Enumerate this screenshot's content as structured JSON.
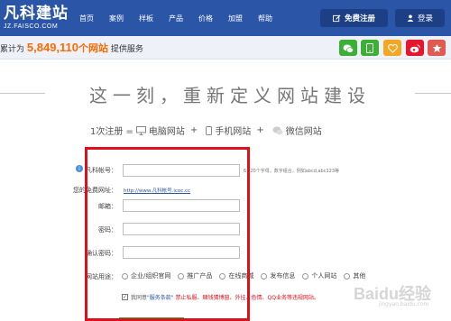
{
  "header": {
    "logo_main": "凡科建站",
    "logo_sub": "JZ.FAISCO.COM",
    "nav": [
      "首页",
      "案例",
      "样板",
      "产品",
      "价格",
      "加盟",
      "帮助"
    ],
    "register_label": "免费注册",
    "login_label": "登录"
  },
  "stats": {
    "prefix": "累计为",
    "count": "5,849,110",
    "unit": "个网站",
    "suffix": "提供服务"
  },
  "social": [
    {
      "icon": "wechat-icon",
      "color": "#3cb034"
    },
    {
      "icon": "mobile-icon",
      "color": "#3cb034"
    },
    {
      "icon": "heart-icon",
      "color": "#f5a623"
    },
    {
      "icon": "weibo-icon",
      "color": "#e6162d"
    },
    {
      "icon": "qzone-icon",
      "color": "#e05a52"
    }
  ],
  "slogan": "这一刻，重新定义网站建设",
  "subline": {
    "prefix": "1次注册 =",
    "pc": "电脑网站",
    "plus": "+",
    "mobile": "手机网站",
    "plus2": "+",
    "wechat": "微信网站"
  },
  "form": {
    "account_label": "凡科帐号：",
    "account_hint": "6~20个字母，数字组合，例如abcd,abc123等",
    "free_site_label": "您的免费网址：",
    "free_site_url": "http://www.凡科帐号.icoc.cc",
    "email_label": "邮箱：",
    "password_label": "密码：",
    "confirm_label": "确认密码：",
    "purpose_label": "网站用途：",
    "purpose_options": [
      "企业/组织官网",
      "推广产品",
      "在线商城",
      "发布信息",
      "个人网站",
      "其他"
    ],
    "agree_prefix": "我同意",
    "agree_terms": "\"服务条款\"",
    "agree_rest": "禁止私服、赌钱猜博窗、外挂、色情、QQ业务等违规网站。"
  },
  "watermark": "Baidu经验",
  "watermark_sub": "jingyan.baidu.com"
}
